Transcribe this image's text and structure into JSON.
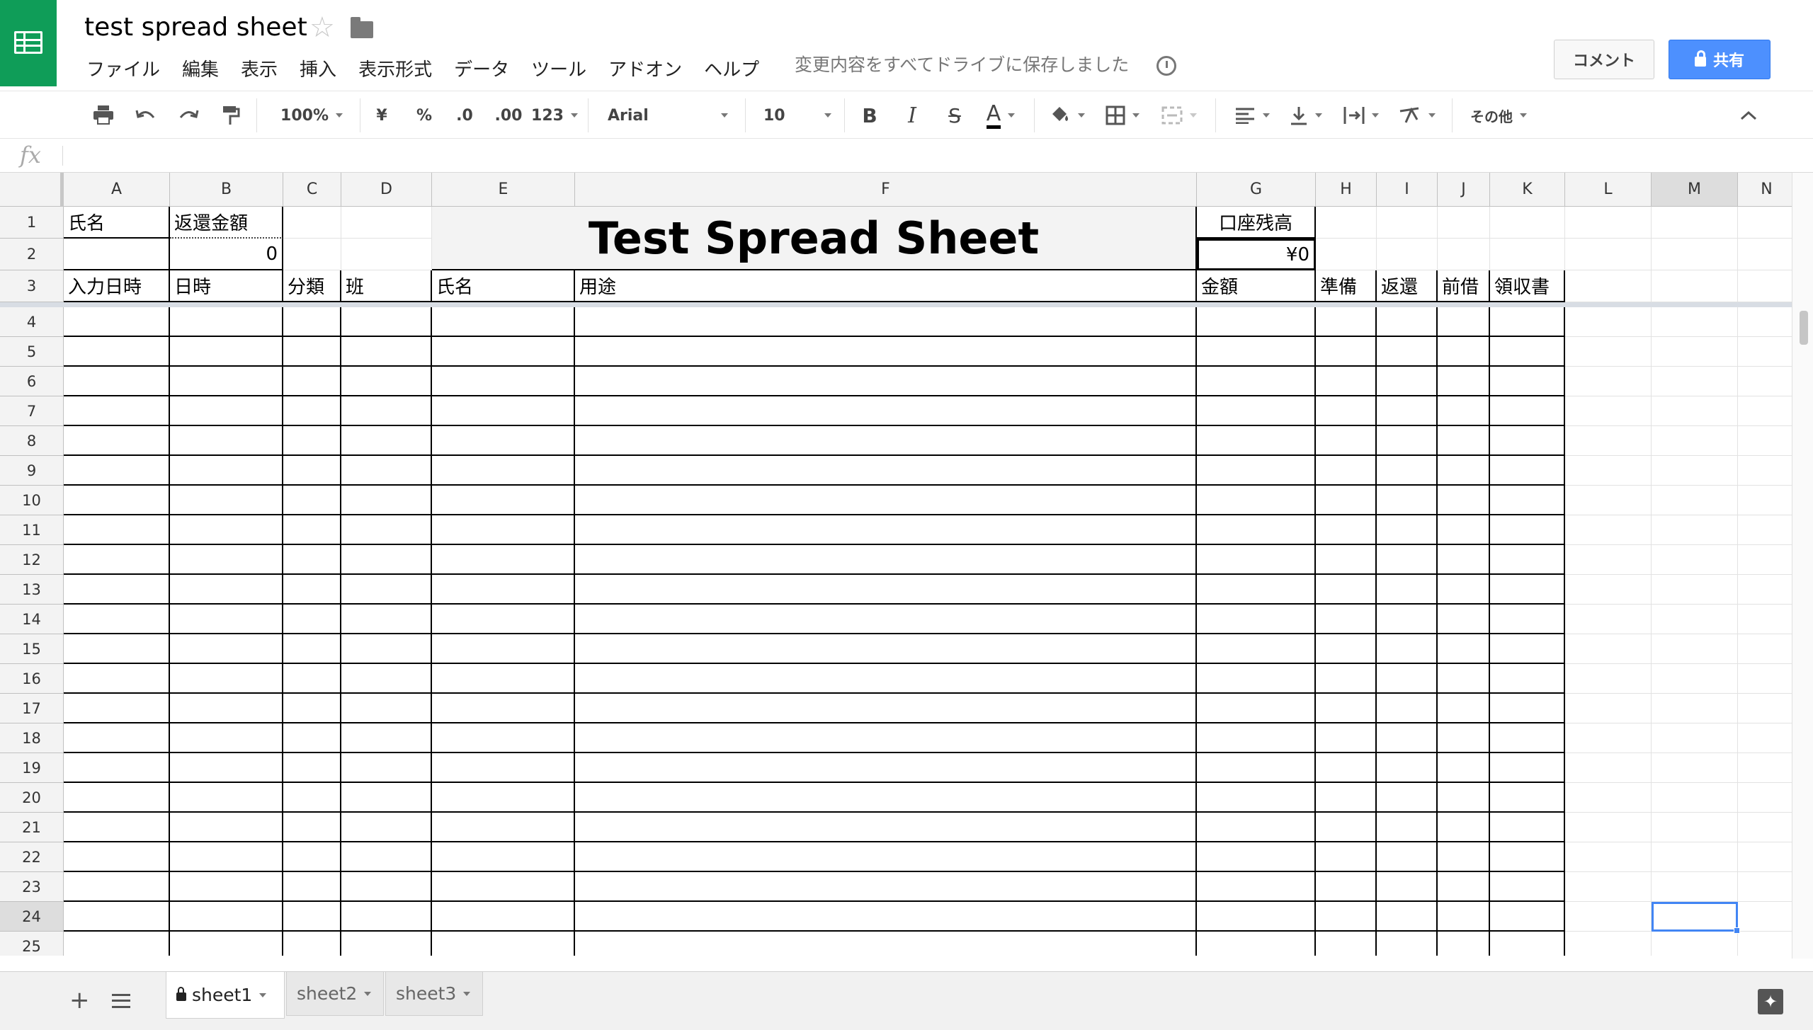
{
  "app": {
    "title": "test spread sheet",
    "save_status": "変更内容をすべてドライブに保存しました",
    "comment_label": "コメント",
    "share_label": "共有",
    "brand_color": "#0f9d58",
    "share_color": "#4d90fe"
  },
  "menu": [
    "ファイル",
    "編集",
    "表示",
    "挿入",
    "表示形式",
    "データ",
    "ツール",
    "アドオン",
    "ヘルプ"
  ],
  "toolbar": {
    "zoom": "100%",
    "currency": "¥",
    "percent": "%",
    "decimal_decrease": ".0",
    "decimal_increase": ".00",
    "more_formats": "123",
    "font": "Arial",
    "font_size": "10",
    "bold": "B",
    "italic": "I",
    "strike": "S",
    "text_color": "A",
    "more": "その他"
  },
  "formula_bar": {
    "fx": "fx",
    "value": ""
  },
  "columns": [
    "A",
    "B",
    "C",
    "D",
    "E",
    "F",
    "G",
    "H",
    "I",
    "J",
    "K",
    "L",
    "M",
    "N"
  ],
  "rows": [
    "1",
    "2",
    "3",
    "4",
    "5",
    "6",
    "7",
    "8",
    "9",
    "10",
    "11",
    "12",
    "13",
    "14",
    "15",
    "16",
    "17",
    "18",
    "19",
    "20",
    "21",
    "22",
    "23",
    "24",
    "25"
  ],
  "selected_column": "M",
  "selected_row": "24",
  "cells": {
    "A1": "氏名",
    "B1": "返還金額",
    "B2": "0",
    "title": "Test Spread Sheet",
    "G1": "口座残高",
    "G2": "¥0",
    "header_row": [
      "入力日時",
      "日時",
      "分類",
      "班",
      "氏名",
      "用途",
      "金額",
      "準備",
      "返還",
      "前借",
      "領収書"
    ]
  },
  "sheets": [
    "sheet1",
    "sheet2",
    "sheet3"
  ],
  "active_sheet": "sheet1"
}
